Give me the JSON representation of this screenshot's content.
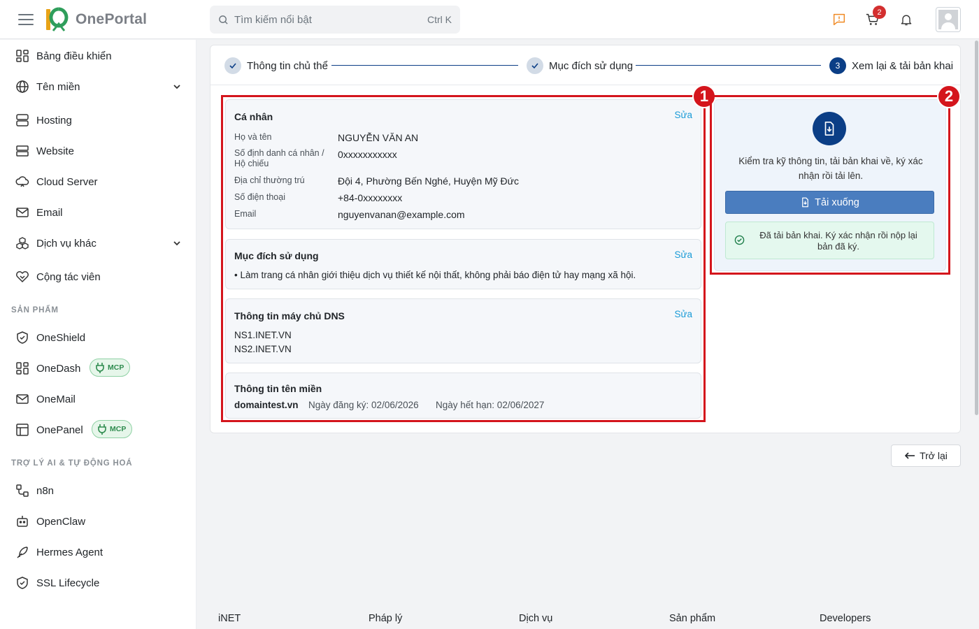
{
  "topbar": {
    "logo_text": "OnePortal",
    "search_placeholder": "Tìm kiếm nổi bật",
    "search_shortcut": "Ctrl K",
    "cart_count": "2",
    "feedback_color": "#f08a24"
  },
  "sidebar": {
    "items": [
      {
        "label": "Bảng điều khiển",
        "icon": "dashboard-icon"
      },
      {
        "label": "Tên miền",
        "icon": "globe-icon"
      },
      {
        "label": "Hosting",
        "icon": "server-icon"
      },
      {
        "label": "Website",
        "icon": "website-icon"
      },
      {
        "label": "Cloud Server",
        "icon": "cloud-icon"
      },
      {
        "label": "Email",
        "icon": "mail-icon"
      },
      {
        "label": "Dịch vụ khác",
        "icon": "boxes-icon"
      },
      {
        "label": "Cộng tác viên",
        "icon": "handshake-icon"
      }
    ],
    "section_products": "SẢN PHẨM",
    "products": [
      {
        "label": "OneShield",
        "icon": "shield-icon"
      },
      {
        "label": "OneDash",
        "icon": "dashboard-icon",
        "badge": "MCP"
      },
      {
        "label": "OneMail",
        "icon": "mail-icon"
      },
      {
        "label": "OnePanel",
        "icon": "panel-icon",
        "badge": "MCP"
      }
    ],
    "section_ai": "TRỢ LÝ AI & TỰ ĐỘNG HOÁ",
    "ai": [
      {
        "label": "n8n",
        "icon": "workflow-icon"
      },
      {
        "label": "OpenClaw",
        "icon": "robot-icon"
      },
      {
        "label": "Hermes Agent",
        "icon": "feather-icon"
      },
      {
        "label": "SSL Lifecycle",
        "icon": "shield-check-icon"
      }
    ]
  },
  "stepper": {
    "steps": [
      {
        "label": "Thông tin chủ thể",
        "state": "done"
      },
      {
        "label": "Mục đích sử dụng",
        "state": "done"
      },
      {
        "label": "Xem lại & tải bản khai",
        "state": "active",
        "number": "3"
      }
    ]
  },
  "review": {
    "personal": {
      "title": "Cá nhân",
      "edit": "Sửa",
      "fields": [
        {
          "key": "Họ và tên",
          "value": "NGUYỄN VĂN AN"
        },
        {
          "key": "Số định danh cá nhân / Hộ chiếu",
          "value": "0xxxxxxxxxxx"
        },
        {
          "key": "Địa chỉ thường trú",
          "value": "Đội 4, Phường Bến Nghé, Huyện Mỹ Đức"
        },
        {
          "key": "Số điện thoại",
          "value": "+84-0xxxxxxxx"
        },
        {
          "key": "Email",
          "value": "nguyenvanan@example.com"
        }
      ]
    },
    "purpose": {
      "title": "Mục đích sử dụng",
      "edit": "Sửa",
      "text": "• Làm trang cá nhân giới thiệu dịch vụ thiết kế nội thất, không phải báo điện tử hay mạng xã hội."
    },
    "dns": {
      "title": "Thông tin máy chủ DNS",
      "edit": "Sửa",
      "servers": [
        "NS1.INET.VN",
        "NS2.INET.VN"
      ]
    },
    "domain": {
      "title": "Thông tin tên miền",
      "name": "domaintest.vn",
      "registered": "Ngày đăng ký: 02/06/2026",
      "expires": "Ngày hết hạn: 02/06/2027"
    }
  },
  "download_panel": {
    "instruction": "Kiểm tra kỹ thông tin, tải bản khai về, ký xác nhận rồi tải lên.",
    "button": "Tải xuống",
    "success": "Đã tải bản khai. Ký xác nhận rồi nộp lại bản đã ký."
  },
  "annotations": {
    "box1": "1",
    "box2": "2",
    "color": "#d4151c"
  },
  "back_button": "Trở lại",
  "footer": [
    "iNET",
    "Pháp lý",
    "Dịch vụ",
    "Sản phẩm",
    "Developers"
  ]
}
